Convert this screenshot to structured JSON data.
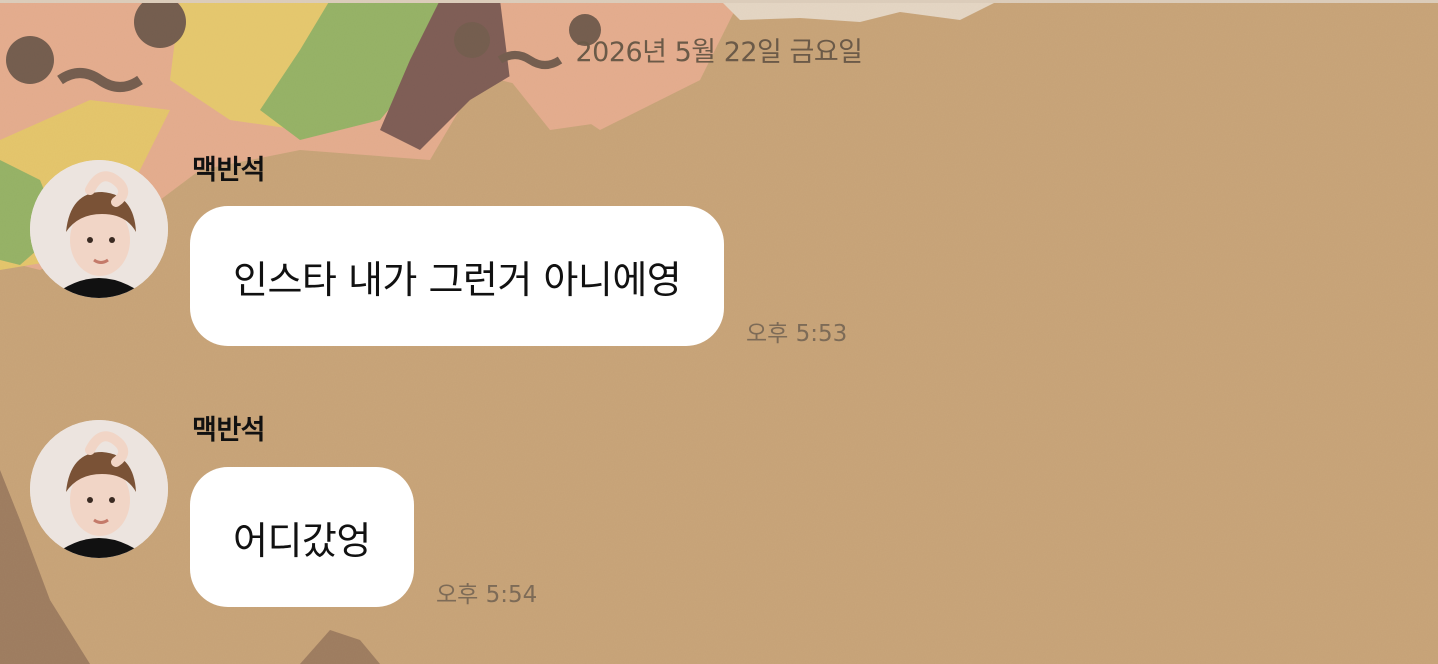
{
  "chat": {
    "date_separator": "2026년 5월 22일 금요일",
    "messages": [
      {
        "sender": "맥반석",
        "text": "인스타 내가 그런거 아니에영",
        "time": "오후 5:53"
      },
      {
        "sender": "맥반석",
        "text": "어디갔엉",
        "time": "오후 5:54"
      }
    ]
  },
  "colors": {
    "background": "#c9a57a",
    "bubble": "#ffffff",
    "timestamp": "#7d6b57"
  }
}
